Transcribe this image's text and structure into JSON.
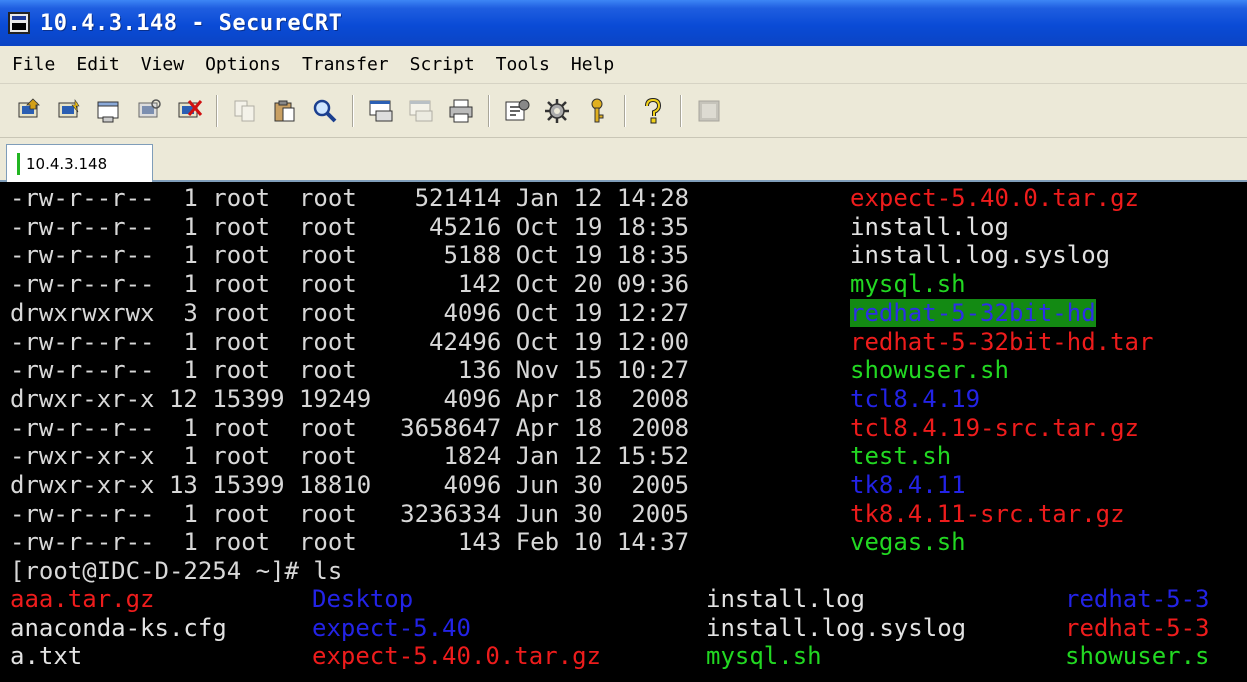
{
  "window": {
    "title": "10.4.3.148 - SecureCRT"
  },
  "menu": [
    {
      "label": "File"
    },
    {
      "label": "Edit"
    },
    {
      "label": "View"
    },
    {
      "label": "Options"
    },
    {
      "label": "Transfer"
    },
    {
      "label": "Script"
    },
    {
      "label": "Tools"
    },
    {
      "label": "Help"
    }
  ],
  "toolbar": {
    "icons": [
      "connect-icon",
      "quick-connect-icon",
      "connect-in-tab-icon",
      "reconnect-icon",
      "disconnect-icon",
      "copy-icon",
      "paste-icon",
      "find-icon",
      "print-screen-icon",
      "print-selection-icon",
      "print-icon",
      "session-options-icon",
      "global-options-icon",
      "keymap-icon",
      "help-icon",
      "sftp-icon"
    ]
  },
  "tab": {
    "label": "10.4.3.148"
  },
  "colors": {
    "red": "#ee1c1c",
    "green": "#22d822",
    "blue": "#2323e6",
    "highlight_bg": "#138a13"
  },
  "listing": [
    {
      "meta": "-rw-r--r--  1 root  root    521414 Jan 12 14:28 ",
      "name": "expect-5.40.0.tar.gz",
      "color": "red"
    },
    {
      "meta": "-rw-r--r--  1 root  root     45216 Oct 19 18:35 ",
      "name": "install.log",
      "color": "white"
    },
    {
      "meta": "-rw-r--r--  1 root  root      5188 Oct 19 18:35 ",
      "name": "install.log.syslog",
      "color": "white"
    },
    {
      "meta": "-rw-r--r--  1 root  root       142 Oct 20 09:36 ",
      "name": "mysql.sh",
      "color": "green"
    },
    {
      "meta": "drwxrwxrwx  3 root  root      4096 Oct 19 12:27 ",
      "name": "redhat-5-32bit-hd",
      "color": "hl"
    },
    {
      "meta": "-rw-r--r--  1 root  root     42496 Oct 19 12:00 ",
      "name": "redhat-5-32bit-hd.tar",
      "color": "red"
    },
    {
      "meta": "-rw-r--r--  1 root  root       136 Nov 15 10:27 ",
      "name": "showuser.sh",
      "color": "green"
    },
    {
      "meta": "drwxr-xr-x 12 15399 19249     4096 Apr 18  2008 ",
      "name": "tcl8.4.19",
      "color": "blue"
    },
    {
      "meta": "-rw-r--r--  1 root  root   3658647 Apr 18  2008 ",
      "name": "tcl8.4.19-src.tar.gz",
      "color": "red"
    },
    {
      "meta": "-rwxr-xr-x  1 root  root      1824 Jan 12 15:52 ",
      "name": "test.sh",
      "color": "green"
    },
    {
      "meta": "drwxr-xr-x 13 15399 18810     4096 Jun 30  2005 ",
      "name": "tk8.4.11",
      "color": "blue"
    },
    {
      "meta": "-rw-r--r--  1 root  root   3236334 Jun 30  2005 ",
      "name": "tk8.4.11-src.tar.gz",
      "color": "red"
    },
    {
      "meta": "-rw-r--r--  1 root  root       143 Feb 10 14:37 ",
      "name": "vegas.sh",
      "color": "green"
    }
  ],
  "prompt": "[root@IDC-D-2254 ~]# ls",
  "ls_rows": [
    [
      {
        "text": "aaa.tar.gz",
        "color": "red"
      },
      {
        "text": "Desktop",
        "color": "blue"
      },
      {
        "text": "install.log",
        "color": "white"
      },
      {
        "text": "redhat-5-3",
        "color": "blue"
      }
    ],
    [
      {
        "text": "anaconda-ks.cfg",
        "color": "white"
      },
      {
        "text": "expect-5.40",
        "color": "blue"
      },
      {
        "text": "install.log.syslog",
        "color": "white"
      },
      {
        "text": "redhat-5-3",
        "color": "red"
      }
    ],
    [
      {
        "text": "a.txt",
        "color": "white"
      },
      {
        "text": "expect-5.40.0.tar.gz",
        "color": "red"
      },
      {
        "text": "mysql.sh",
        "color": "green"
      },
      {
        "text": "showuser.s",
        "color": "green"
      }
    ]
  ]
}
